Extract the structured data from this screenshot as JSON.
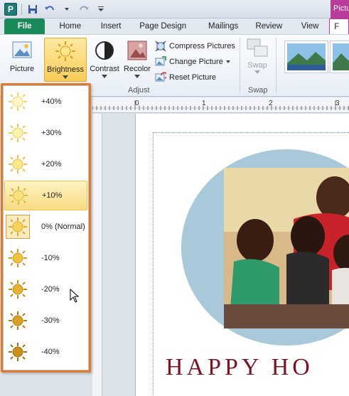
{
  "quick_access": {
    "app_icon_letter": "P",
    "context_tab_label": "Pictu"
  },
  "tabs": [
    {
      "label": "File"
    },
    {
      "label": "Home"
    },
    {
      "label": "Insert"
    },
    {
      "label": "Page Design"
    },
    {
      "label": "Mailings"
    },
    {
      "label": "Review"
    },
    {
      "label": "View"
    },
    {
      "label": "F"
    }
  ],
  "ribbon": {
    "picture_label": "Picture",
    "brightness_label": "Brightness",
    "contrast_label": "Contrast",
    "recolor_label": "Recolor",
    "compress_label": "Compress Pictures",
    "change_label": "Change Picture",
    "reset_label": "Reset Picture",
    "adjust_group": "Adjust",
    "swap_label": "Swap",
    "swap_group": "Swap"
  },
  "ruler": {
    "numbers": [
      "0",
      "1",
      "2",
      "3"
    ]
  },
  "brightness_options": [
    {
      "label": "+40%"
    },
    {
      "label": "+30%"
    },
    {
      "label": "+20%"
    },
    {
      "label": "+10%"
    },
    {
      "label": "0% (Normal)"
    },
    {
      "label": "-10%"
    },
    {
      "label": "-20%"
    },
    {
      "label": "-30%"
    },
    {
      "label": "-40%"
    }
  ],
  "document": {
    "card_text": "HAPPY HO"
  },
  "colors": {
    "file_tab": "#1b8a5a",
    "context_tab": "#b93c9b",
    "highlight_border": "#e07a2a",
    "card_text": "#7a1424"
  }
}
